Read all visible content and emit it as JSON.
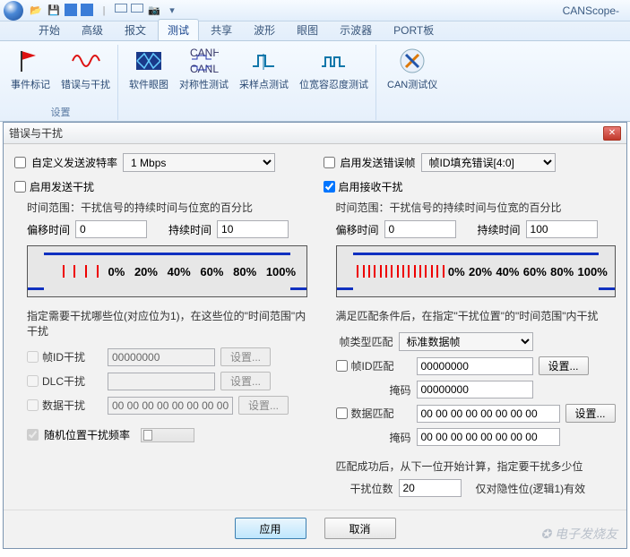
{
  "app": {
    "title": "CANScope-"
  },
  "qat_icons": [
    "open",
    "save",
    "bluebox1",
    "bluebox2",
    "sep",
    "layout1",
    "layout2",
    "camera",
    "dropdown"
  ],
  "tabs": [
    "开始",
    "高级",
    "报文",
    "测试",
    "共享",
    "波形",
    "眼图",
    "示波器",
    "PORT板"
  ],
  "active_tab": 3,
  "ribbon": {
    "groups": [
      {
        "caption": "设置",
        "buttons": [
          {
            "name": "event-marker",
            "label": "事件标记",
            "icon": "flag"
          },
          {
            "name": "error-interference",
            "label": "错误与干扰",
            "icon": "wave-red"
          }
        ]
      },
      {
        "caption": "",
        "buttons": [
          {
            "name": "software-eye",
            "label": "软件眼图",
            "icon": "eye-blue"
          },
          {
            "name": "symmetry-test",
            "label": "对称性测试",
            "icon": "canh-canl"
          },
          {
            "name": "sample-test",
            "label": "采样点测试",
            "icon": "pulse"
          },
          {
            "name": "bit-tolerance-test",
            "label": "位宽容忍度测试",
            "icon": "pulse2"
          }
        ]
      },
      {
        "caption": "",
        "buttons": [
          {
            "name": "can-tester",
            "label": "CAN测试仪",
            "icon": "blue-a"
          }
        ]
      }
    ]
  },
  "dialog": {
    "title": "错误与干扰",
    "left": {
      "custom_baud": {
        "label": "自定义发送波特率",
        "checked": false,
        "value": "1 Mbps"
      },
      "enable_tx_interf": {
        "label": "启用发送干扰",
        "checked": false
      },
      "timerange_desc": "时间范围：干扰信号的持续时间与位宽的百分比",
      "offset_label": "偏移时间",
      "offset_value": "0",
      "duration_label": "持续时间",
      "duration_value": "10",
      "percent_labels": [
        "0%",
        "20%",
        "40%",
        "60%",
        "80%",
        "100%"
      ],
      "specify_desc": "指定需要干扰哪些位(对应位为1)，在这些位的\"时间范围\"内干扰",
      "frameid": {
        "label": "帧ID干扰",
        "value": "00000000",
        "btn": "设置..."
      },
      "dlc": {
        "label": "DLC干扰",
        "value": "",
        "btn": "设置..."
      },
      "data": {
        "label": "数据干扰",
        "value": "00 00 00 00 00 00 00 00",
        "btn": "设置..."
      },
      "random": {
        "label": "随机位置干扰频率",
        "checked": true
      }
    },
    "right": {
      "enable_tx_err": {
        "label": "启用发送错误帧",
        "checked": false,
        "combo": "帧ID填充错误[4:0]"
      },
      "enable_rx_interf": {
        "label": "启用接收干扰",
        "checked": true
      },
      "timerange_desc": "时间范围：干扰信号的持续时间与位宽的百分比",
      "offset_label": "偏移时间",
      "offset_value": "0",
      "duration_label": "持续时间",
      "duration_value": "100",
      "percent_labels": [
        "0%",
        "20%",
        "40%",
        "60%",
        "80%",
        "100%"
      ],
      "match_desc": "满足匹配条件后，在指定\"干扰位置\"的\"时间范围\"内干扰",
      "frametype": {
        "label": "帧类型匹配",
        "value": "标准数据帧"
      },
      "frameid": {
        "label": "帧ID匹配",
        "value": "00000000",
        "btn": "设置..."
      },
      "frameid_mask": {
        "label": "掩码",
        "value": "00000000"
      },
      "data": {
        "label": "数据匹配",
        "value": "00 00 00 00 00 00 00 00",
        "btn": "设置..."
      },
      "data_mask": {
        "label": "掩码",
        "value": "00 00 00 00 00 00 00 00"
      },
      "success_desc": "匹配成功后，从下一位开始计算，指定要干扰多少位",
      "bits": {
        "label": "干扰位数",
        "value": "20",
        "note": "仅对隐性位(逻辑1)有效"
      }
    },
    "footer": {
      "apply": "应用",
      "cancel": "取消"
    }
  }
}
